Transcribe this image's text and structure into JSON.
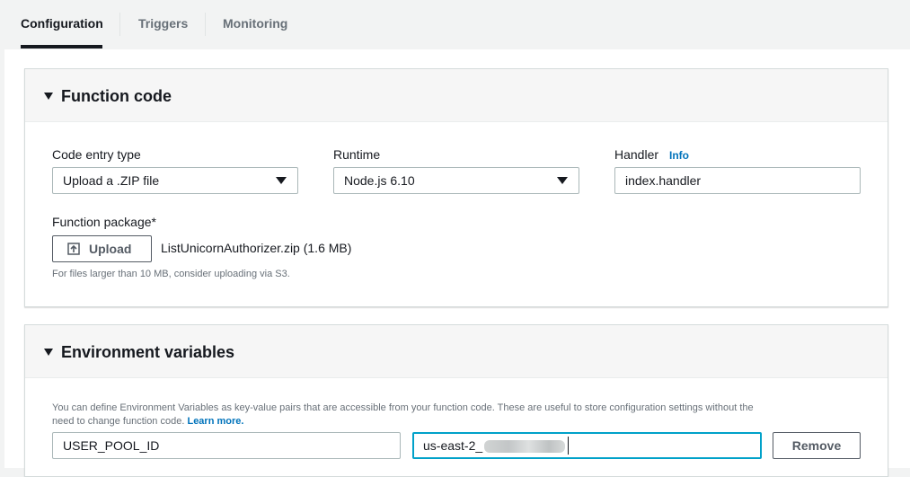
{
  "tabs": [
    {
      "label": "Configuration",
      "active": true
    },
    {
      "label": "Triggers",
      "active": false
    },
    {
      "label": "Monitoring",
      "active": false
    }
  ],
  "function_code": {
    "title": "Function code",
    "code_entry_type": {
      "label": "Code entry type",
      "value": "Upload a .ZIP file"
    },
    "runtime": {
      "label": "Runtime",
      "value": "Node.js 6.10"
    },
    "handler": {
      "label": "Handler",
      "info": "Info",
      "value": "index.handler"
    },
    "package": {
      "label": "Function package*",
      "upload_button": "Upload",
      "file_name": "ListUnicornAuthorizer.zip (1.6 MB)",
      "help": "For files larger than 10 MB, consider uploading via S3."
    }
  },
  "environment_variables": {
    "title": "Environment variables",
    "description_line1": "You can define Environment Variables as key-value pairs that are accessible from your function code. These are useful to store configuration settings without the",
    "description_line2": "need to change function code.",
    "learn_more": "Learn more.",
    "key": "USER_POOL_ID",
    "value_prefix": "us-east-2_",
    "remove_button": "Remove"
  },
  "colors": {
    "accent_link": "#0073bb",
    "focus_border": "#00a1c9",
    "text": "#16191f"
  },
  "icons": [
    "caret-down-icon",
    "dropdown-arrow-icon",
    "upload-icon"
  ]
}
